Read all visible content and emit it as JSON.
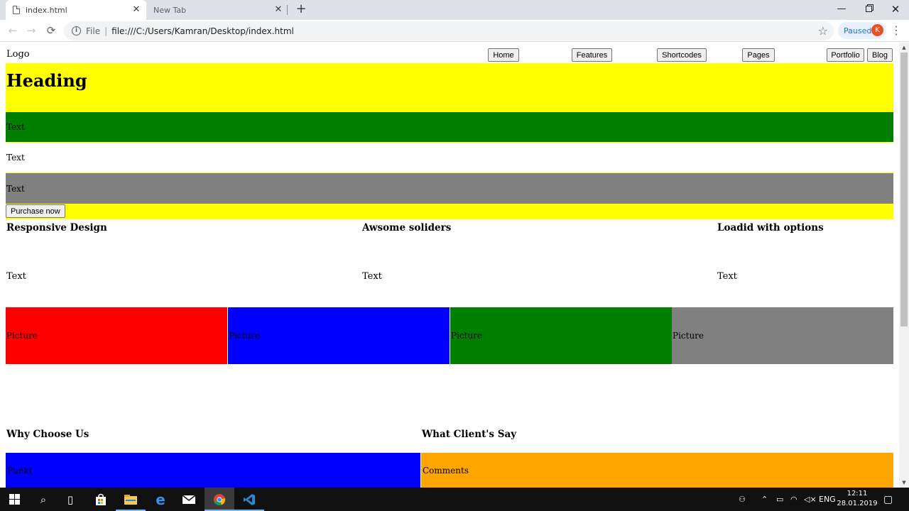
{
  "browser": {
    "tabs": [
      {
        "title": "index.html",
        "close": "✕"
      },
      {
        "title": "New Tab",
        "close": "✕"
      }
    ],
    "new_tab": "+",
    "window_controls": {
      "minimize": "—",
      "close": "✕"
    },
    "nav": {
      "back": "←",
      "forward": "→",
      "reload": "⟳"
    },
    "address": {
      "scheme": "File",
      "separator": "|",
      "url": "file:///C:/Users/Kamran/Desktop/index.html"
    },
    "profile": {
      "label": "Paused",
      "initial": "K"
    }
  },
  "page": {
    "logo": "Logo",
    "nav": [
      "Home",
      "Features",
      "Shortcodes",
      "Pages",
      "Portfolio",
      "Blog"
    ],
    "hero": {
      "heading": "Heading",
      "bands": [
        "Text",
        "Text",
        "Text"
      ],
      "button": "Purchase now",
      "colors": {
        "hero": "#ffff00",
        "band1": "#008000",
        "band2": "#ffffff",
        "band3": "#808080"
      }
    },
    "features": [
      {
        "title": "Responsive Design",
        "text": "Text"
      },
      {
        "title": "Awsome soliders",
        "text": "Text"
      },
      {
        "title": "Loadid with options",
        "text": "Text"
      }
    ],
    "pictures": [
      {
        "label": "Picture",
        "color": "#ff0000"
      },
      {
        "label": "Picture",
        "color": "#0000ff"
      },
      {
        "label": "Picture",
        "color": "#008000"
      },
      {
        "label": "Picture",
        "color": "#808080"
      }
    ],
    "sections": [
      {
        "title": "Why Choose Us",
        "block": "Punkt",
        "color": "#0000ff"
      },
      {
        "title": "What Client's Say",
        "block": "Comments",
        "color": "#ffa500"
      }
    ]
  },
  "taskbar": {
    "icons": [
      "start-icon",
      "search-icon",
      "task-view-icon",
      "store-icon",
      "file-explorer-icon",
      "edge-icon",
      "mail-icon",
      "chrome-icon",
      "vscode-icon"
    ],
    "language": "ENG",
    "time": "12:11",
    "date": "28.01.2019"
  }
}
